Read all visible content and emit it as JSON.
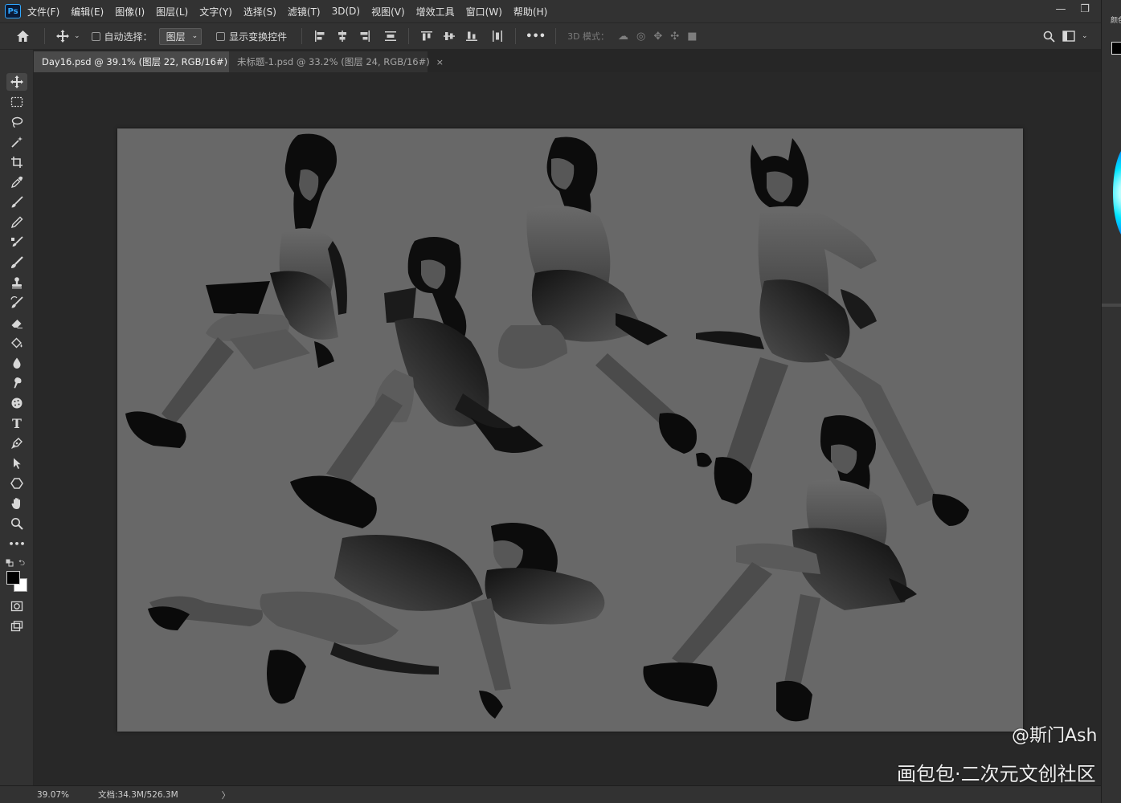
{
  "app": {
    "logo_text": "Ps"
  },
  "menu": {
    "items": [
      "文件(F)",
      "编辑(E)",
      "图像(I)",
      "图层(L)",
      "文字(Y)",
      "选择(S)",
      "滤镜(T)",
      "3D(D)",
      "视图(V)",
      "增效工具",
      "窗口(W)",
      "帮助(H)"
    ]
  },
  "window_controls": {
    "minimize": "—",
    "restore": "❐",
    "close": "✕"
  },
  "options_bar": {
    "home_icon": "home-icon",
    "move_icon": "move-tool-icon",
    "auto_select_label": "自动选择：",
    "layer_select_value": "图层",
    "show_transform_label": "显示变换控件",
    "more_label": "•••",
    "mode_3d_label": "3D 模式："
  },
  "tabs": [
    {
      "label": "Day16.psd @ 39.1% (图层 22, RGB/16#) *",
      "active": true
    },
    {
      "label": "未标题-1.psd @ 33.2% (图层 24, RGB/16#)",
      "active": false
    }
  ],
  "tab_close": "×",
  "panel_collapse": "»",
  "tools": [
    "move-icon",
    "marquee-icon",
    "lasso-icon",
    "magic-wand-icon",
    "crop-icon",
    "eyedropper-icon",
    "brush-icon",
    "pencil-icon",
    "clone-brush-icon",
    "mixer-brush-icon",
    "stamp-icon",
    "history-brush-icon",
    "eraser-icon",
    "paint-bucket-icon",
    "blur-icon",
    "smudge-icon",
    "sponge-icon",
    "type-icon",
    "pen-icon",
    "path-select-icon",
    "shape-icon",
    "hand-icon",
    "zoom-icon",
    "more-tools-icon"
  ],
  "tool_glyphs": {
    "type": "T",
    "more": "•••"
  },
  "colors": {
    "foreground": "#000000",
    "background": "#ffffff",
    "accent": "#31a8ff",
    "canvas_gray": "#686868"
  },
  "status": {
    "zoom": "39.07%",
    "doc_info": "文档:34.3M/526.3M",
    "arrow": "〉"
  },
  "right_panel": {
    "label": "颜色"
  },
  "watermark": {
    "user": "@斯门Ash",
    "site": "画包包·二次元文创社区"
  }
}
